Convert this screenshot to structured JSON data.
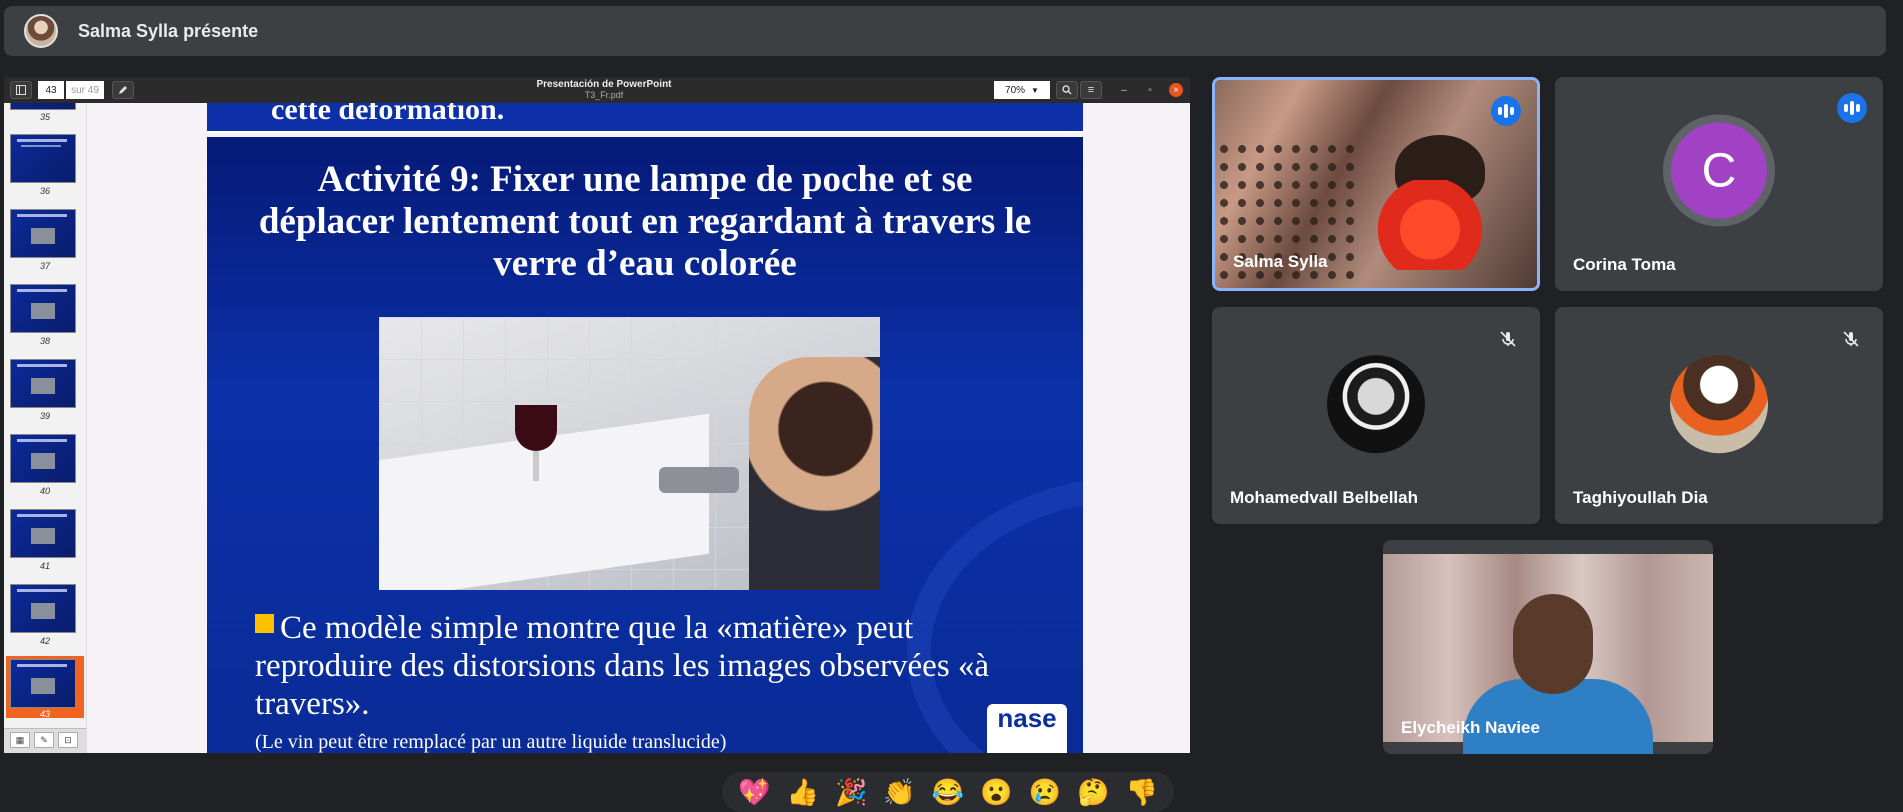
{
  "presenter_bar": {
    "title": "Salma Sylla présente"
  },
  "viewer": {
    "page_current": "43",
    "page_of": "sur 49",
    "window_title": "Presentación de PowerPoint",
    "file_name": "T3_Fr.pdf",
    "zoom": "70%",
    "thumbnails": [
      {
        "num": "35"
      },
      {
        "num": "36"
      },
      {
        "num": "37"
      },
      {
        "num": "38"
      },
      {
        "num": "39"
      },
      {
        "num": "40"
      },
      {
        "num": "41"
      },
      {
        "num": "42"
      },
      {
        "num": "43",
        "active": true
      }
    ]
  },
  "slide": {
    "prev_text": "cette déformation.",
    "title": "Activité 9: Fixer une lampe de poche et se déplacer lentement tout en regardant à travers le verre d’eau colorée",
    "bullet": "Ce modèle simple montre que la «matière» peut reproduire des distorsions dans les images observées «à travers».",
    "note": "(Le vin peut être remplacé par un autre liquide translucide)",
    "logo": "nase"
  },
  "participants": {
    "p1": {
      "name": "Salma Sylla",
      "status": "speaking"
    },
    "p2": {
      "name": "Corina Toma",
      "initial": "C",
      "status": "speaking"
    },
    "p3": {
      "name": "Mohamedvall Belbellah",
      "status": "muted"
    },
    "p4": {
      "name": "Taghiyoullah Dia",
      "status": "muted"
    },
    "p5": {
      "name": "Elycheikh Naviee"
    }
  },
  "reactions": [
    "💖",
    "👍",
    "🎉",
    "👏",
    "😂",
    "😮",
    "😢",
    "🤔",
    "👎"
  ],
  "colors": {
    "speaking_blue": "#1a73e8",
    "active_border": "#8ab4f8",
    "thumb_active": "#f06320",
    "avatar_purple": "#a142c4"
  }
}
